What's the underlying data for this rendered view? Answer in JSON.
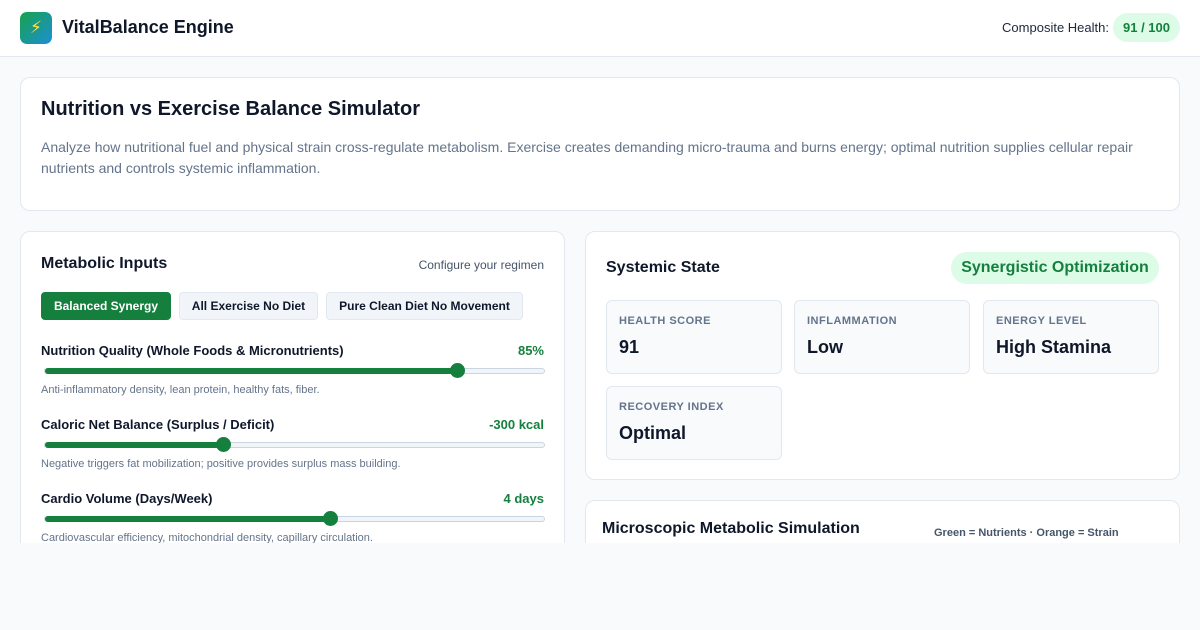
{
  "header": {
    "logo_icon": "lightning-bolt-icon",
    "logo_glyph": "⚡",
    "app_title": "VitalBalance Engine",
    "health_label": "Composite Health:",
    "health_value": "91 / 100"
  },
  "intro": {
    "title": "Nutrition vs Exercise Balance Simulator",
    "description": "Analyze how nutritional fuel and physical strain cross-regulate metabolism. Exercise creates demanding micro-trauma and burns energy; optimal nutrition supplies cellular repair nutrients and controls systemic inflammation."
  },
  "inputs": {
    "title": "Metabolic Inputs",
    "hint": "Configure your regimen",
    "presets": [
      {
        "label": "Balanced Synergy",
        "active": true
      },
      {
        "label": "All Exercise No Diet",
        "active": false
      },
      {
        "label": "Pure Clean Diet No Movement",
        "active": false
      }
    ],
    "sliders": [
      {
        "label": "Nutrition Quality (Whole Foods & Micronutrients)",
        "value": "85%",
        "level": 0.825,
        "description": "Anti-inflammatory density, lean protein, healthy fats, fiber."
      },
      {
        "label": "Caloric Net Balance (Surplus / Deficit)",
        "value": "-300 kcal",
        "level": 0.356,
        "description": "Negative triggers fat mobilization; positive provides surplus mass building."
      },
      {
        "label": "Cardio Volume (Days/Week)",
        "value": "4 days",
        "level": 0.571,
        "description": "Cardiovascular efficiency, mitochondrial density, capillary circulation."
      }
    ]
  },
  "state": {
    "title": "Systemic State",
    "badge": "Synergistic Optimization",
    "metrics": [
      {
        "label": "HEALTH SCORE",
        "value": "91"
      },
      {
        "label": "INFLAMMATION",
        "value": "Low"
      },
      {
        "label": "ENERGY LEVEL",
        "value": "High Stamina"
      },
      {
        "label": "RECOVERY INDEX",
        "value": "Optimal"
      }
    ]
  },
  "simulation": {
    "title": "Microscopic Metabolic Simulation",
    "legend": "Green = Nutrients · Orange = Strain"
  },
  "colors": {
    "accent": "#15803d",
    "badge_bg": "#dcfce7",
    "muted_text": "#64748b"
  }
}
